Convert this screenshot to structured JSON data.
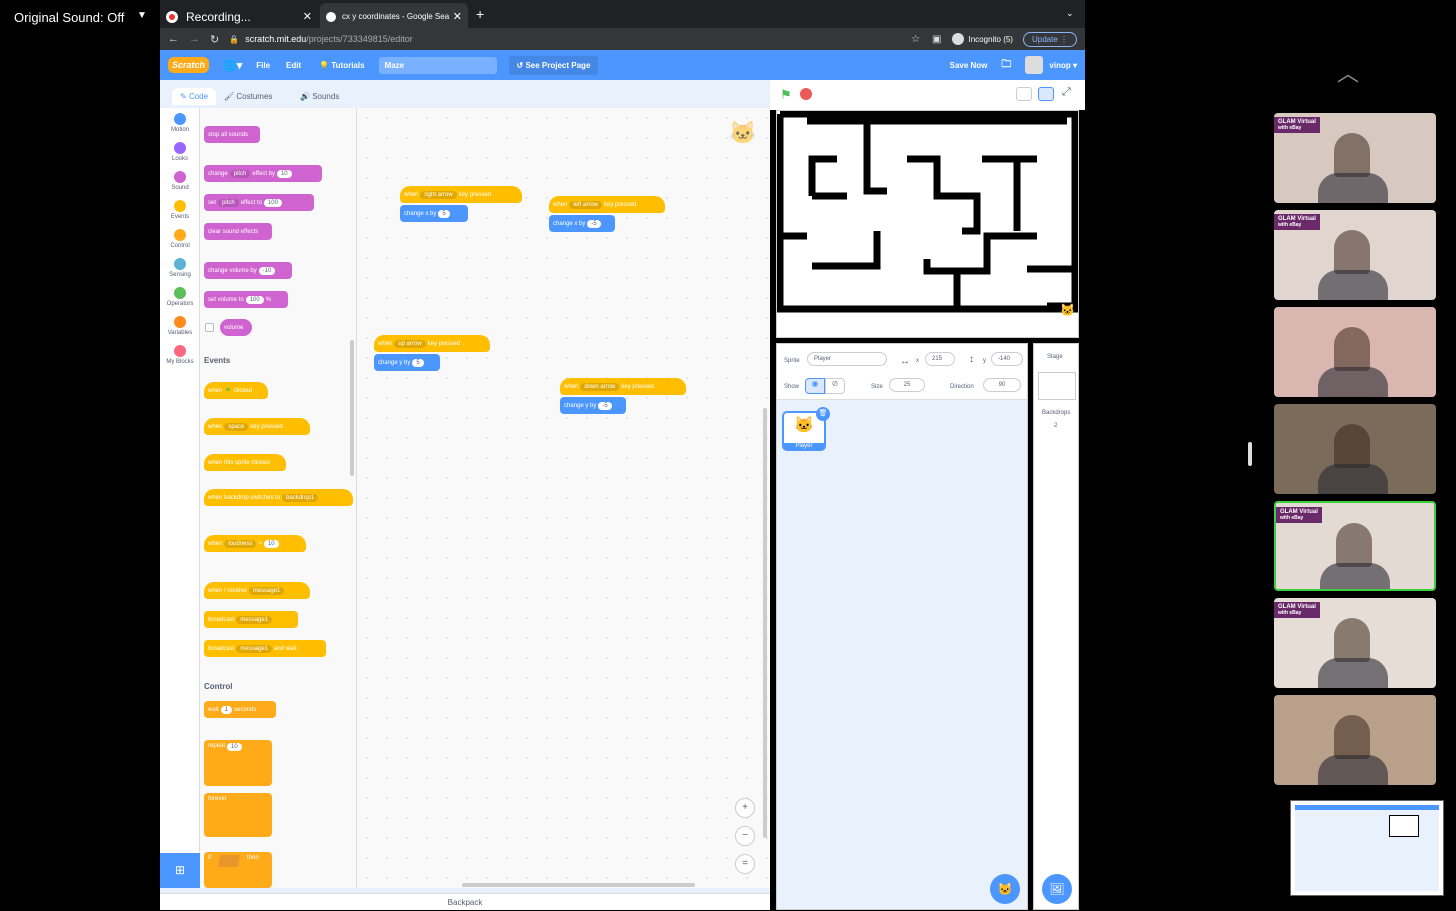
{
  "zoom_bar": {
    "original_sound": "Original Sound: Off",
    "recording": "Recording..."
  },
  "browser": {
    "tab1": "Recording...",
    "tab2": "cx y coordinates - Google Sea",
    "url_host": "scratch.mit.edu",
    "url_path": "/projects/733349815/editor",
    "incognito": "Incognito (5)",
    "update": "Update"
  },
  "menubar": {
    "logo": "Scratch",
    "file": "File",
    "edit": "Edit",
    "tutorials": "Tutorials",
    "project_title": "Maze",
    "see_project": "See Project Page",
    "save_now": "Save Now",
    "user": "vinop"
  },
  "editor_tabs": {
    "code": "Code",
    "costumes": "Costumes",
    "sounds": "Sounds"
  },
  "categories": [
    {
      "label": "Motion",
      "color": "#4c97ff"
    },
    {
      "label": "Looks",
      "color": "#9966ff"
    },
    {
      "label": "Sound",
      "color": "#cf63cf"
    },
    {
      "label": "Events",
      "color": "#ffbf00"
    },
    {
      "label": "Control",
      "color": "#ffab19"
    },
    {
      "label": "Sensing",
      "color": "#5cb1d6"
    },
    {
      "label": "Operators",
      "color": "#59c059"
    },
    {
      "label": "Variables",
      "color": "#ff8c1a"
    },
    {
      "label": "My Blocks",
      "color": "#ff6680"
    }
  ],
  "palette": {
    "stop_all_sounds": "stop all sounds",
    "change_pitch": "change",
    "pitch": "pitch",
    "effect_by": "effect by",
    "pitch_change_val": "10",
    "set": "set",
    "effect_to": "effect to",
    "pitch_set_val": "100",
    "clear_effects": "clear sound effects",
    "change_volume": "change volume by",
    "volume_change_val": "-10",
    "set_volume": "set volume to",
    "volume_set_val": "100",
    "percent": "%",
    "volume": "volume",
    "events_header": "Events",
    "when": "when",
    "clicked": "clicked",
    "space": "space",
    "key_pressed": "key pressed",
    "when_sprite_clicked": "when this sprite clicked",
    "when_backdrop": "when backdrop switches to",
    "backdrop1": "backdrop1",
    "loudness": "loudness",
    "gt": ">",
    "loudness_val": "10",
    "when_receive": "when I receive",
    "message1": "message1",
    "broadcast": "broadcast",
    "and_wait": "and wait",
    "control_header": "Control",
    "wait": "wait",
    "wait_val": "1",
    "seconds": "seconds",
    "repeat": "repeat",
    "repeat_val": "10",
    "forever": "forever",
    "if": "if",
    "then": "then"
  },
  "scripts": [
    {
      "key": "right arrow",
      "action": "change x by",
      "value": "5"
    },
    {
      "key": "left arrow",
      "action": "change x by",
      "value": "-5"
    },
    {
      "key": "up arrow",
      "action": "change y by",
      "value": "5"
    },
    {
      "key": "down arrow",
      "action": "change y by",
      "value": "-5"
    }
  ],
  "sprite_info": {
    "sprite_label": "Sprite",
    "sprite_name": "Player",
    "x_label": "x",
    "x_val": "215",
    "y_label": "y",
    "y_val": "-140",
    "show_label": "Show",
    "size_label": "Size",
    "size_val": "25",
    "direction_label": "Direction",
    "direction_val": "90",
    "thumb_name": "Player"
  },
  "stage_panel": {
    "label": "Stage",
    "backdrops": "Backdrops",
    "count": "2"
  },
  "backpack": "Backpack",
  "participants": [
    {
      "badge": "GLAM Virtual",
      "sub": "with eBay",
      "bg": "#d8c9c0"
    },
    {
      "badge": "GLAM Virtual",
      "sub": "with eBay",
      "bg": "#e0d6cf"
    },
    {
      "badge": "",
      "sub": "",
      "bg": "#d9b7b0"
    },
    {
      "badge": "",
      "sub": "",
      "bg": "#7a6b5a"
    },
    {
      "badge": "GLAM Virtual",
      "sub": "with eBay",
      "bg": "#e3dad4"
    },
    {
      "badge": "GLAM Virtual",
      "sub": "with eBay",
      "bg": "#e6ddd6"
    },
    {
      "badge": "",
      "sub": "",
      "bg": "#b8a08a"
    }
  ]
}
